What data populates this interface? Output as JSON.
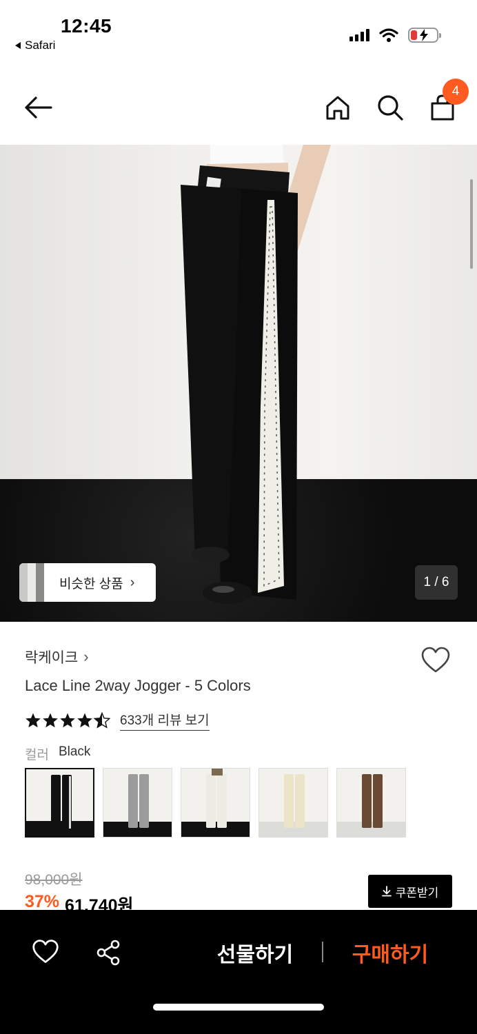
{
  "status_bar": {
    "time": "12:45",
    "back_app": "Safari",
    "battery_color": "#e53935"
  },
  "nav": {
    "back_icon": "arrow-left-icon",
    "icons": [
      "home-icon",
      "search-icon",
      "cart-icon"
    ],
    "cart_count": "4",
    "badge_color": "#ff5a1f"
  },
  "hero": {
    "similar_label": "비슷한 상품",
    "page_indicator": "1 / 6"
  },
  "product": {
    "brand": "락케이크",
    "name": "Lace Line 2way Jogger - 5 Colors",
    "rating_stars": 4.5,
    "review_link": "633개 리뷰 보기",
    "color_key": "컬러",
    "color_value": "Black",
    "swatches": [
      {
        "color": "Black",
        "leg": "#111111",
        "selected": true
      },
      {
        "color": "Gray",
        "leg": "#9b9b9b",
        "selected": false
      },
      {
        "color": "Ivory",
        "leg": "#ecebe4",
        "selected": false
      },
      {
        "color": "Cream",
        "leg": "#ece4c9",
        "selected": false
      },
      {
        "color": "Brown",
        "leg": "#6a4a32",
        "selected": false
      }
    ]
  },
  "price": {
    "original": "98,000원",
    "discount": "37%",
    "final": "61,740원",
    "coupon_label": "쿠폰받기"
  },
  "bottom_bar": {
    "icons": [
      "heart-icon",
      "share-icon"
    ],
    "gift_label": "선물하기",
    "buy_label": "구매하기",
    "accent": "#ff5a1f"
  }
}
